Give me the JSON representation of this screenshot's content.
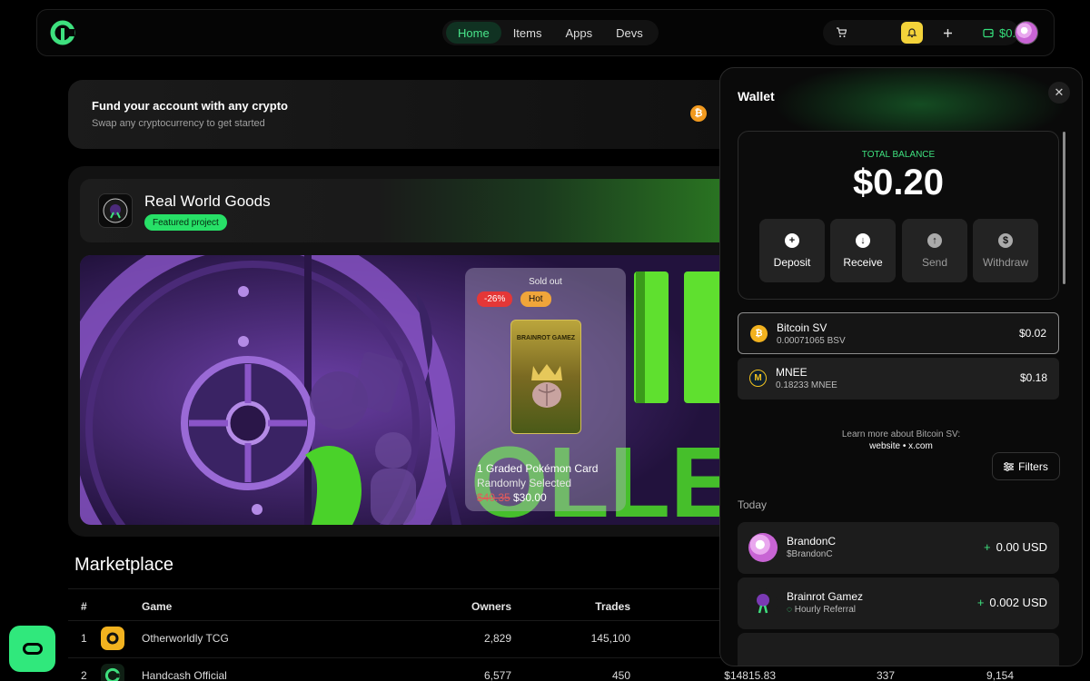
{
  "nav": {
    "tabs": [
      {
        "label": "Home",
        "active": true
      },
      {
        "label": "Items",
        "active": false
      },
      {
        "label": "Apps",
        "active": false
      },
      {
        "label": "Devs",
        "active": false
      }
    ],
    "balance": "$0.20",
    "icons": [
      "cart-icon",
      "bell-icon",
      "plus-icon",
      "wallet-icon"
    ]
  },
  "fund_banner": {
    "title": "Fund your account with any crypto",
    "subtitle": "Swap any cryptocurrency to get started",
    "coin_glyph": "₿"
  },
  "featured": {
    "name": "Real World Goods",
    "tag": "Featured project",
    "card": {
      "status": "Sold out",
      "discount": "-26%",
      "badge": "Hot",
      "pack_text": "BRAINROT GAMEZ",
      "title": "1 Graded Pokémon Card",
      "subtitle": "Randomly Selected",
      "old_price": "$40.35",
      "price": "$30.00"
    }
  },
  "marketplace": {
    "title": "Marketplace",
    "columns": [
      "#",
      "Game",
      "Owners",
      "Trades"
    ],
    "rows": [
      {
        "rank": "1",
        "game": "Otherworldly TCG",
        "owners": "2,829",
        "trades": "145,100",
        "volume": "",
        "col6": "",
        "col7": ""
      },
      {
        "rank": "2",
        "game": "Handcash Official",
        "owners": "6,577",
        "trades": "450",
        "volume": "$14815.83",
        "col6": "337",
        "col7": "9,154"
      }
    ]
  },
  "wallet": {
    "title": "Wallet",
    "balance_label": "TOTAL BALANCE",
    "balance": "$0.20",
    "actions": [
      {
        "label": "Deposit",
        "icon": "plus-circle-icon",
        "glyph": "+"
      },
      {
        "label": "Receive",
        "icon": "arrow-down-icon",
        "glyph": "↓"
      },
      {
        "label": "Send",
        "icon": "arrow-up-icon",
        "glyph": "↑"
      },
      {
        "label": "Withdraw",
        "icon": "dollar-icon",
        "glyph": "$"
      }
    ],
    "assets": [
      {
        "name": "Bitcoin SV",
        "amount": "0.00071065 BSV",
        "value": "$0.02",
        "glyph": "₿"
      },
      {
        "name": "MNEE",
        "amount": "0.18233 MNEE",
        "value": "$0.18",
        "glyph": "M"
      }
    ],
    "learn_text": "Learn more about Bitcoin SV:",
    "learn_links": "website • x.com",
    "filters_label": "Filters",
    "today_label": "Today",
    "transactions": [
      {
        "name": "BrandonC",
        "sub": "$BrandonC",
        "amount": "0.00 USD"
      },
      {
        "name": "Brainrot Gamez",
        "sub": "Hourly Referral",
        "amount": "0.002 USD"
      }
    ]
  },
  "colors": {
    "accent": "#30e87c",
    "bell": "#f3d33a",
    "bitcoin": "#f29a1f",
    "discount": "#e43737",
    "hot": "#f0a53a"
  }
}
